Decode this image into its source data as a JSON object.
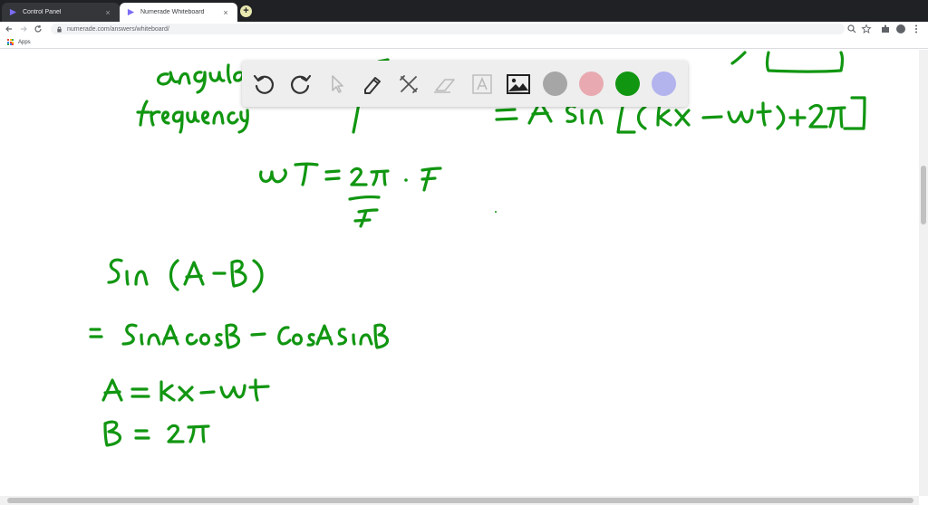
{
  "browser": {
    "tabs": [
      {
        "title": "Control Panel",
        "active": false,
        "close_glyph": "×"
      },
      {
        "title": "Numerade Whiteboard",
        "active": true,
        "close_glyph": "×"
      }
    ],
    "new_tab_glyph": "+",
    "address": "numerade.com/answers/whiteboard/",
    "bookmarks": [
      {
        "label": "Apps"
      }
    ]
  },
  "whiteboard": {
    "tools": [
      {
        "name": "undo-icon"
      },
      {
        "name": "redo-icon"
      },
      {
        "name": "select-cursor-icon"
      },
      {
        "name": "pen-icon"
      },
      {
        "name": "tools-icon"
      },
      {
        "name": "eraser-icon"
      },
      {
        "name": "text-icon"
      },
      {
        "name": "image-icon"
      }
    ],
    "colors": [
      "#a6a6a6",
      "#e8aab0",
      "#119611",
      "#b3b3ee"
    ],
    "ink_color": "#119611",
    "handwritten_lines": [
      "angular",
      "frequency",
      "= A sin[(kx - wt) + 2π]",
      "wT = 2π · F",
      "F",
      "Sin (A - B)",
      "= SinA cos B - CosA sinB",
      "A = kx - wt",
      "B = 2π"
    ]
  }
}
